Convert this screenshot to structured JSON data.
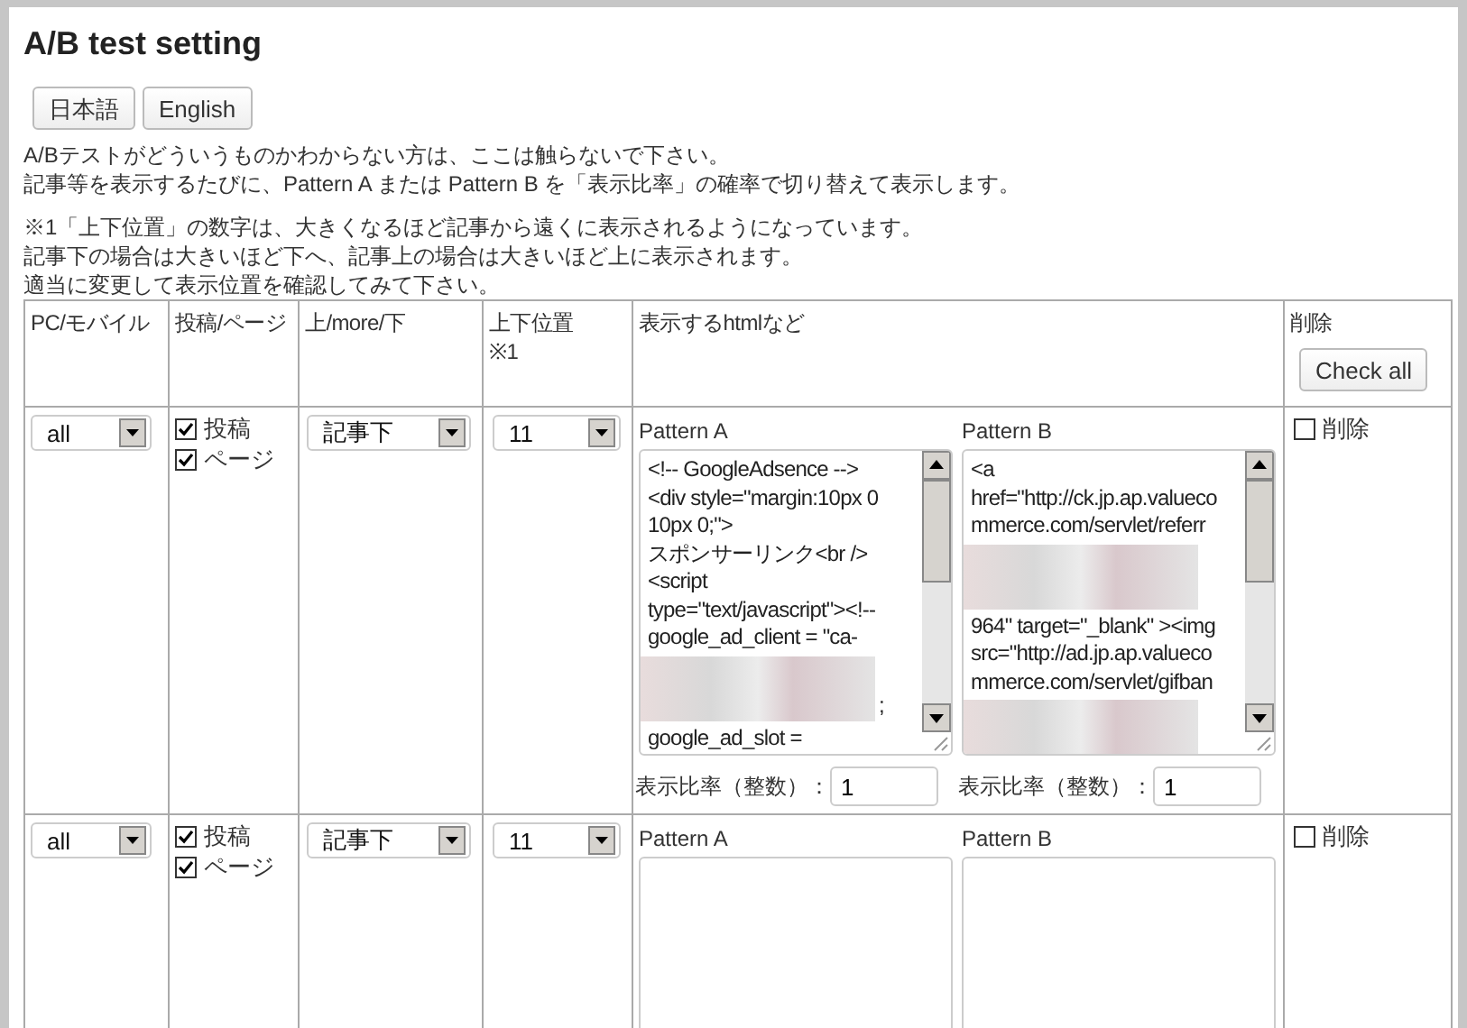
{
  "title": "A/B test setting",
  "language_buttons": [
    {
      "label": "日本語"
    },
    {
      "label": "English"
    }
  ],
  "intro": [
    "A/Bテストがどういうものかわからない方は、ここは触らないで下さい。",
    "記事等を表示するたびに、Pattern A または Pattern B を「表示比率」の確率で切り替えて表示します。"
  ],
  "notes": [
    "※1「上下位置」の数字は、大きくなるほど記事から遠くに表示されるようになっています。",
    "記事下の場合は大きいほど下へ、記事上の場合は大きいほど上に表示されます。",
    "適当に変更して表示位置を確認してみて下さい。"
  ],
  "table": {
    "columns": [
      {
        "label": "PC/モバイル"
      },
      {
        "label": "投稿/ページ"
      },
      {
        "label": "上/more/下"
      },
      {
        "label": "上下位置",
        "note": "※1"
      },
      {
        "label": "表示するhtmlなど"
      },
      {
        "label": "削除"
      }
    ],
    "check_all": "Check all",
    "rows": [
      {
        "device": "all",
        "types": [
          {
            "label": "投稿",
            "checked": true
          },
          {
            "label": "ページ",
            "checked": true
          }
        ],
        "placement": "記事下",
        "order": "11",
        "patterns": [
          {
            "label": "Pattern A",
            "lines": [
              {
                "kind": "text",
                "text": "<!-- GoogleAdsence -->"
              },
              {
                "kind": "text",
                "text": "<div style=\"margin:10px 0"
              },
              {
                "kind": "text",
                "text": "10px 0;\">"
              },
              {
                "kind": "text",
                "text": "スポンサーリンク<br />"
              },
              {
                "kind": "text",
                "text": "<script"
              },
              {
                "kind": "text",
                "text": "type=\"text/javascript\"><!--"
              },
              {
                "kind": "text",
                "text": "google_ad_client = \"ca-"
              },
              {
                "kind": "redacted",
                "tail": ";"
              },
              {
                "kind": "text",
                "text": "google_ad_slot ="
              }
            ],
            "ratio_label": "表示比率（整数）：",
            "ratio": "1"
          },
          {
            "label": "Pattern B",
            "lines": [
              {
                "kind": "text",
                "text": "<a"
              },
              {
                "kind": "text",
                "text": "href=\"http://ck.jp.ap.valueco"
              },
              {
                "kind": "text",
                "text": "mmerce.com/servlet/referr"
              },
              {
                "kind": "redacted"
              },
              {
                "kind": "text",
                "text": "964\" target=\"_blank\" ><img"
              },
              {
                "kind": "text",
                "text": "src=\"http://ad.jp.ap.valueco"
              },
              {
                "kind": "text",
                "text": "mmerce.com/servlet/gifban"
              },
              {
                "kind": "redacted"
              }
            ],
            "ratio_label": "表示比率（整数）：",
            "ratio": "1"
          }
        ],
        "delete": {
          "label": "削除",
          "checked": false
        }
      },
      {
        "device": "all",
        "types": [
          {
            "label": "投稿",
            "checked": true
          },
          {
            "label": "ページ",
            "checked": true
          }
        ],
        "placement": "記事下",
        "order": "11",
        "patterns": [
          {
            "label": "Pattern A"
          },
          {
            "label": "Pattern B"
          }
        ],
        "delete": {
          "label": "削除",
          "checked": false
        }
      }
    ]
  }
}
